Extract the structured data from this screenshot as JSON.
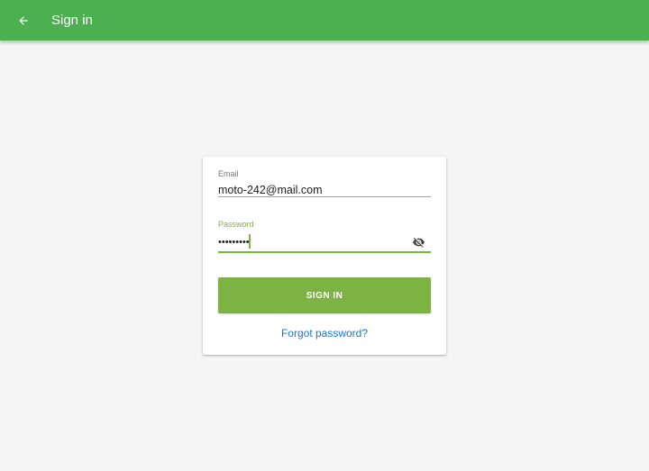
{
  "appbar": {
    "title": "Sign in",
    "back_icon": "arrow-left-icon",
    "color": "#4caf50"
  },
  "form": {
    "email_label": "Email",
    "email_value": "moto-242@mail.com",
    "password_label": "Password",
    "password_masked": "•••••••••",
    "visibility_icon": "eye-off-icon",
    "accent_color": "#7cb342",
    "signin_label": "SIGN IN",
    "forgot_label": "Forgot password?",
    "link_color": "#1976d2"
  }
}
